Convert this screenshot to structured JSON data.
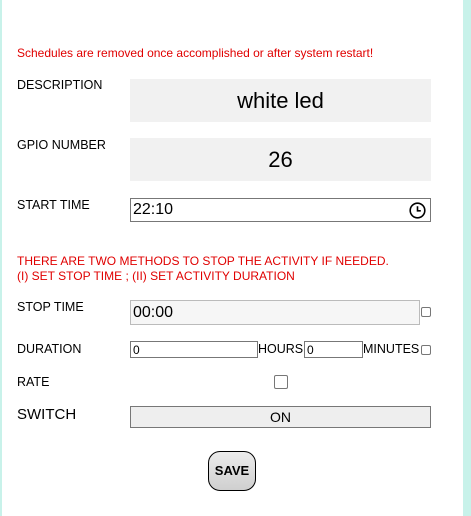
{
  "notice": "Schedules are removed once accomplished or after system restart!",
  "description": {
    "label": "DESCRIPTION",
    "value": "white led"
  },
  "gpio": {
    "label": "GPIO NUMBER",
    "value": "26"
  },
  "start_time": {
    "label": "START TIME",
    "value": "22:10",
    "icon": "clock-icon"
  },
  "methods_notice": {
    "line1": "THERE ARE TWO METHODS TO STOP THE ACTIVITY IF NEEDED.",
    "line2": "(I) SET STOP TIME ; (II) SET ACTIVITY DURATION"
  },
  "stop_time": {
    "label": "STOP TIME",
    "value": "00:00",
    "checked": false
  },
  "duration": {
    "label": "DURATION",
    "hours_value": "0",
    "hours_label": "HOURS",
    "minutes_value": "0",
    "minutes_label": "MINUTES",
    "checked": false
  },
  "rate": {
    "label": "RATE",
    "checked": false
  },
  "switch": {
    "label": "SWITCH",
    "button": "ON"
  },
  "save_button": "SAVE",
  "colors": {
    "warning": "#e00000",
    "edge": "#c8f2ea",
    "field_bg": "#f1f1f1"
  }
}
